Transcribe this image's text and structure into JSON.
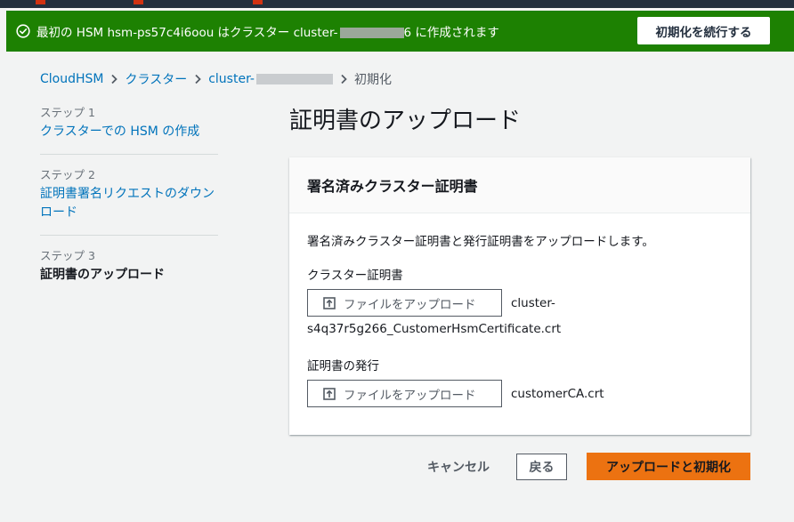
{
  "flash": {
    "message_prefix": "最初の HSM hsm-ps57c4i6oou はクラスター cluster-",
    "message_suffix": "6 に作成されます",
    "continue_button": "初期化を続行する",
    "color": "#1d8102"
  },
  "breadcrumb": {
    "items": [
      "CloudHSM",
      "クラスター",
      "cluster-"
    ],
    "current": "初期化"
  },
  "steps": [
    {
      "label": "ステップ 1",
      "title": "クラスターでの HSM の作成"
    },
    {
      "label": "ステップ 2",
      "title": "証明書署名リクエストのダウンロード"
    },
    {
      "label": "ステップ 3",
      "title": "証明書のアップロード"
    }
  ],
  "page": {
    "title": "証明書のアップロード"
  },
  "panel": {
    "header": "署名済みクラスター証明書",
    "description": "署名済みクラスター証明書と発行証明書をアップロードします。",
    "cluster_cert": {
      "label": "クラスター証明書",
      "button": "ファイルをアップロード",
      "file_line1": "cluster-",
      "file_line2": "s4q37r5g266_CustomerHsmCertificate.crt"
    },
    "issuing_cert": {
      "label": "証明書の発行",
      "button": "ファイルをアップロード",
      "file": "customerCA.crt"
    }
  },
  "actions": {
    "cancel": "キャンセル",
    "back": "戻る",
    "submit": "アップロードと初期化",
    "primary_color": "#ec7211"
  },
  "icons": [
    "success-check-icon",
    "chevron-right-icon",
    "upload-icon"
  ]
}
